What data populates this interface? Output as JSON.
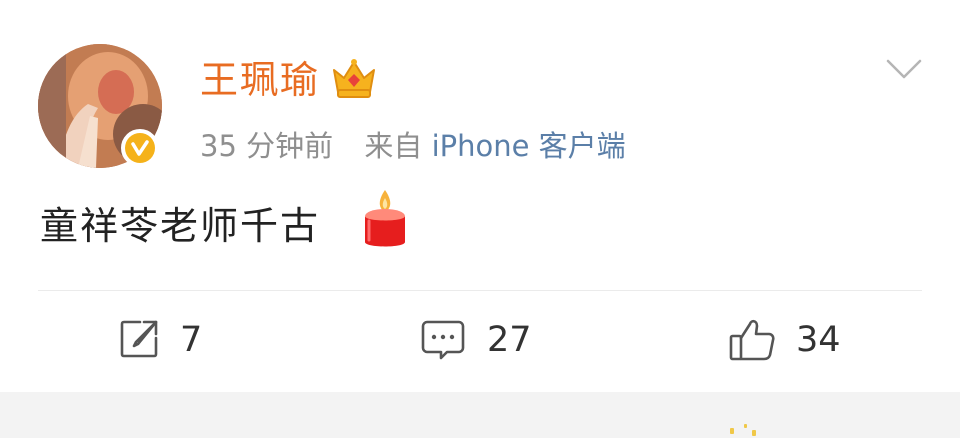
{
  "post": {
    "username": "王珮瑜",
    "time": "35 分钟前",
    "source_prefix": "来自",
    "source": "iPhone 客户端",
    "content": "童祥苓老师千古",
    "icons": {
      "avatar": "avatar-photo",
      "verified": "verified-badge-icon",
      "membership": "crown-icon",
      "menu": "chevron-down-icon",
      "emoji": "candle-icon"
    },
    "colors": {
      "username": "#e86c22",
      "source": "#5b7fa8",
      "verified": "#f5b21a"
    }
  },
  "actions": {
    "repost_count": "7",
    "comment_count": "27",
    "like_count": "34"
  }
}
